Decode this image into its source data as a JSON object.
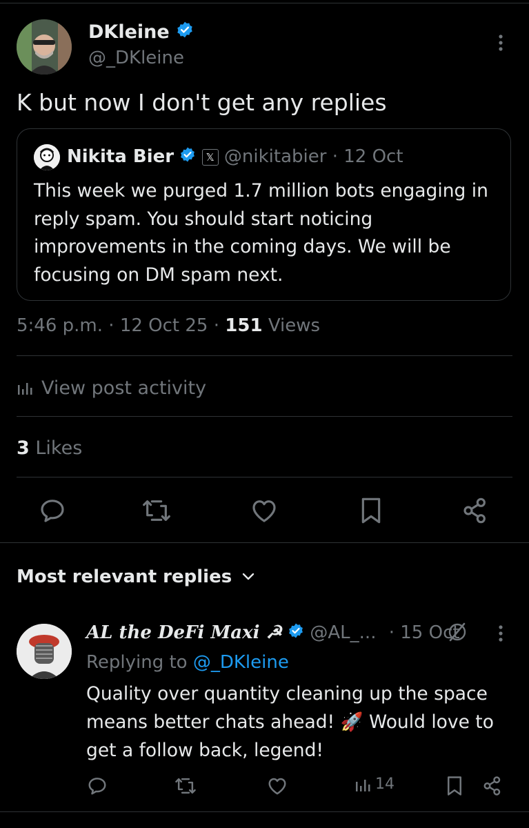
{
  "post": {
    "author_name": "DKleine",
    "author_handle": "@_DKleine",
    "text": "K but now I don't get any replies",
    "quote": {
      "author_name": "Nikita Bier",
      "author_handle": "@nikitabier",
      "date": "12 Oct",
      "affiliate_badge": "𝕏",
      "text": "This week we purged 1.7 million bots engaging in reply spam. You should start noticing improvements in the coming days. We will be focusing on DM spam next."
    },
    "time": "5:46 p.m.",
    "date": "12 Oct 25",
    "views_count": "151",
    "views_label": "Views",
    "activity_label": "View post activity",
    "likes_count": "3",
    "likes_label": "Likes"
  },
  "replies_header": "Most relevant replies",
  "reply": {
    "author_name": "AL the DeFi Maxi ☭",
    "author_handle": "@AL_...",
    "date": "· 15 Oct",
    "replying_prefix": "Replying to",
    "replying_handle": "@_DKleine",
    "text_before_emoji": "Quality over quantity cleaning up the space means better chats ahead!",
    "emoji": "🚀",
    "text_after_emoji": "Would love to get a follow back, legend!",
    "views": "14"
  },
  "colors": {
    "background": "#000000",
    "text": "#e7e9ea",
    "muted": "#71767b",
    "link": "#1d9bf0",
    "divider": "#2f3336"
  },
  "icons": [
    "more-vertical-icon",
    "verified-badge-icon",
    "reply-icon",
    "repost-icon",
    "like-icon",
    "bookmark-icon",
    "share-icon",
    "analytics-icon",
    "chevron-down-icon",
    "grok-slash-icon"
  ]
}
